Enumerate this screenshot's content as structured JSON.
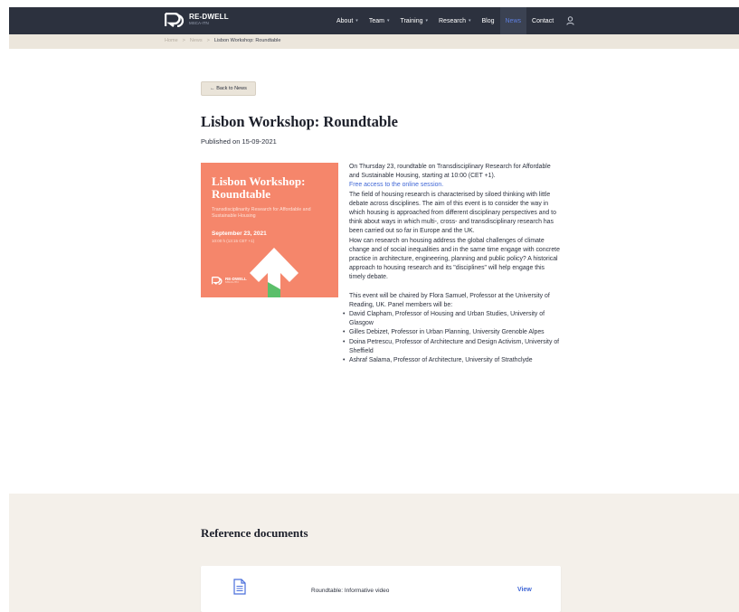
{
  "header": {
    "logo": {
      "name": "RE-DWELL",
      "sub": "MSCA-ITN"
    },
    "nav": [
      {
        "label": "About",
        "caret": "▾"
      },
      {
        "label": "Team",
        "caret": "▾"
      },
      {
        "label": "Training",
        "caret": "▾"
      },
      {
        "label": "Research",
        "caret": "▾"
      },
      {
        "label": "Blog"
      },
      {
        "label": "News",
        "active": true
      },
      {
        "label": "Contact"
      }
    ],
    "user_icon": "user-icon"
  },
  "breadcrumb": {
    "home": "Home",
    "sep": ">",
    "news": "News",
    "current": "Lisbon Workshop: Roundtable"
  },
  "back_button": "← Back to News",
  "article": {
    "title": "Lisbon Workshop: Roundtable",
    "published": "Published on 15-09-2021",
    "paragraph1": "On Thursday 23, roundtable on Transdisciplinary Research for Affordable and Sustainable Housing, starting at 10:00 (CET +1).",
    "link": "Free access to the online session.",
    "paragraph2": "The field of housing research is characterised by siloed thinking with little debate across disciplines. The aim of this event is to consider the way in which housing is approached from different disciplinary perspectives and to think about ways in which multi-, cross- and transdisciplinary research has been carried out so far in Europe and the UK.",
    "paragraph3": "How can research on housing address the global challenges of climate change and of social inequalities and in the same time engage with concrete practice in architecture, engineering, planning and public policy? A historical approach to housing research and its \"disciplines\" will help engage this timely debate.",
    "paragraph4": "This event will be chaired by Flora Samuel, Professor at the University of Reading, UK. Panel members will be:",
    "panel": [
      "David Clapham, Professor of Housing and Urban Studies, University of Glasgow",
      "Gilles Debizet, Professor in Urban Planning, University Grenoble Alpes",
      "Doina Petrescu, Professor of Architecture and Design Activism, University of Sheffield",
      "Ashraf Salama, Professor of Architecture, University of Strathclyde"
    ]
  },
  "poster": {
    "title": "Lisbon Workshop: Roundtable",
    "subtitle": "Transdisciplinarity Research for Affordable and Sustainable Housing",
    "date": "September 23, 2021",
    "time": "10:00 h (13:15 CET +1)",
    "logo_name": "RE-DWELL",
    "logo_sub": "MSCA-ITN",
    "colors": {
      "background": "#f5866b",
      "arrow": "#ffffff",
      "accent": "#5bbf6a"
    }
  },
  "references": {
    "title": "Reference documents",
    "documents": [
      {
        "icon": "document-icon",
        "label": "Roundtable: Informative video",
        "action": "View"
      }
    ]
  },
  "colors": {
    "topbar": "#2c313e",
    "crumbbar": "#ece6dc",
    "link": "#4067d6",
    "reference_bg": "#f4f0ea"
  }
}
